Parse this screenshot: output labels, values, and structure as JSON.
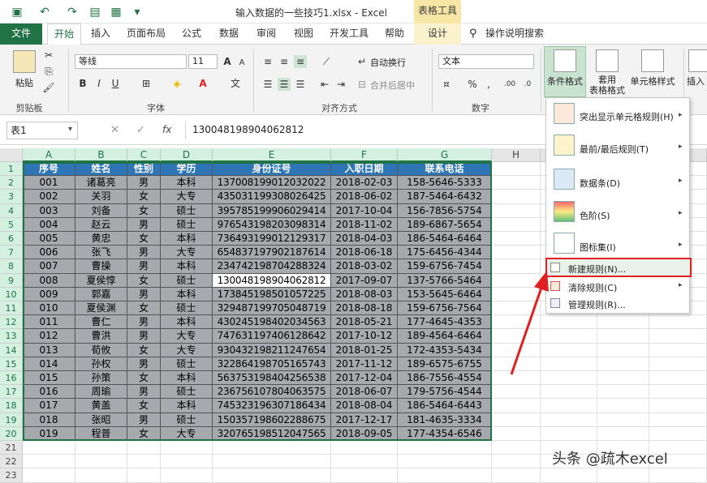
{
  "title_bar": {
    "document_title": "输入数据的一些技巧1.xlsx  -  Excel",
    "context_tool": "表格工具"
  },
  "tabs": {
    "file": "文件",
    "home": "开始",
    "insert": "插入",
    "page_layout": "页面布局",
    "formulas": "公式",
    "data": "数据",
    "review": "审阅",
    "view": "视图",
    "developer": "开发工具",
    "help": "帮助",
    "design": "设计",
    "tell_me": "操作说明搜索"
  },
  "ribbon": {
    "paste": "粘贴",
    "clipboard": "剪贴板",
    "font_name": "等线",
    "font_size": "11",
    "font_group": "字体",
    "wrap_text": "自动换行",
    "merge_center": "合并后居中",
    "alignment_group": "对齐方式",
    "number_format": "文本",
    "number_group": "数字",
    "conditional_format": "条件格式",
    "apply_table": "套用\n表格格式",
    "cell_styles": "单元格样式",
    "insert": "插入"
  },
  "formula_bar": {
    "name_box": "表1",
    "formula": "130048198904062812"
  },
  "columns": [
    "A",
    "B",
    "C",
    "D",
    "E",
    "F",
    "G",
    "H"
  ],
  "table": {
    "headers": [
      "序号",
      "姓名",
      "性别",
      "学历",
      "身份证号",
      "入职日期",
      "联系电话"
    ],
    "rows": [
      [
        "001",
        "诸葛亮",
        "男",
        "本科",
        "137008199012032022",
        "2018-02-03",
        "158-5646-5333"
      ],
      [
        "002",
        "关羽",
        "女",
        "大专",
        "435031199308026425",
        "2018-06-02",
        "187-5464-6432"
      ],
      [
        "003",
        "刘备",
        "女",
        "硕士",
        "395785199906029414",
        "2017-10-04",
        "156-7856-5754"
      ],
      [
        "004",
        "赵云",
        "男",
        "硕士",
        "976543198203098314",
        "2018-11-02",
        "189-6867-5654"
      ],
      [
        "005",
        "黄忠",
        "女",
        "本科",
        "736493199012129317",
        "2018-04-03",
        "186-5464-6464"
      ],
      [
        "006",
        "张飞",
        "男",
        "大专",
        "654837197902187614",
        "2018-06-18",
        "175-6456-4344"
      ],
      [
        "007",
        "曹操",
        "男",
        "本科",
        "234742198704288324",
        "2018-03-02",
        "159-6756-7454"
      ],
      [
        "008",
        "夏侯惇",
        "女",
        "硕士",
        "130048198904062812",
        "2017-09-07",
        "137-5766-5464"
      ],
      [
        "009",
        "郭嘉",
        "男",
        "本科",
        "173845198501057225",
        "2018-08-03",
        "153-5645-6464"
      ],
      [
        "010",
        "夏侯渊",
        "女",
        "硕士",
        "329487199705048719",
        "2018-08-18",
        "159-6756-7564"
      ],
      [
        "011",
        "曹仁",
        "男",
        "本科",
        "430245198402034563",
        "2018-05-21",
        "177-4645-4353"
      ],
      [
        "012",
        "曹洪",
        "男",
        "大专",
        "747631197406128642",
        "2017-10-12",
        "189-4564-6464"
      ],
      [
        "013",
        "荀攸",
        "女",
        "大专",
        "930432198211247654",
        "2018-01-25",
        "172-4353-5434"
      ],
      [
        "014",
        "孙权",
        "男",
        "硕士",
        "322864198705165743",
        "2017-11-12",
        "189-6575-6755"
      ],
      [
        "015",
        "孙策",
        "女",
        "本科",
        "563753198404256538",
        "2017-12-04",
        "186-7556-4554"
      ],
      [
        "016",
        "周瑜",
        "男",
        "硕士",
        "236756107804063575",
        "2018-06-07",
        "179-5756-4544"
      ],
      [
        "017",
        "黄盖",
        "女",
        "本科",
        "745323196307186434",
        "2018-08-04",
        "186-5464-6443"
      ],
      [
        "018",
        "张昭",
        "男",
        "硕士",
        "150357198602288675",
        "2017-12-17",
        "181-4635-3334"
      ],
      [
        "019",
        "程普",
        "女",
        "大专",
        "320765198512047565",
        "2018-09-05",
        "177-4354-6546"
      ]
    ]
  },
  "empty_rows": [
    "21",
    "22",
    "23"
  ],
  "cf_menu": {
    "highlight_rules": "突出显示单元格规则(H)",
    "top_bottom": "最前/最后规则(T)",
    "data_bars": "数据条(D)",
    "color_scales": "色阶(S)",
    "icon_sets": "图标集(I)",
    "new_rule": "新建规则(N)...",
    "clear_rules": "清除规则(C)",
    "manage_rules": "管理规则(R)..."
  },
  "watermark": "头条 @疏木excel",
  "colors": {
    "excel_green": "#217346",
    "header_blue": "#2e75b6",
    "data_gray": "#a6a9ad",
    "highlight_red": "#e02020"
  }
}
